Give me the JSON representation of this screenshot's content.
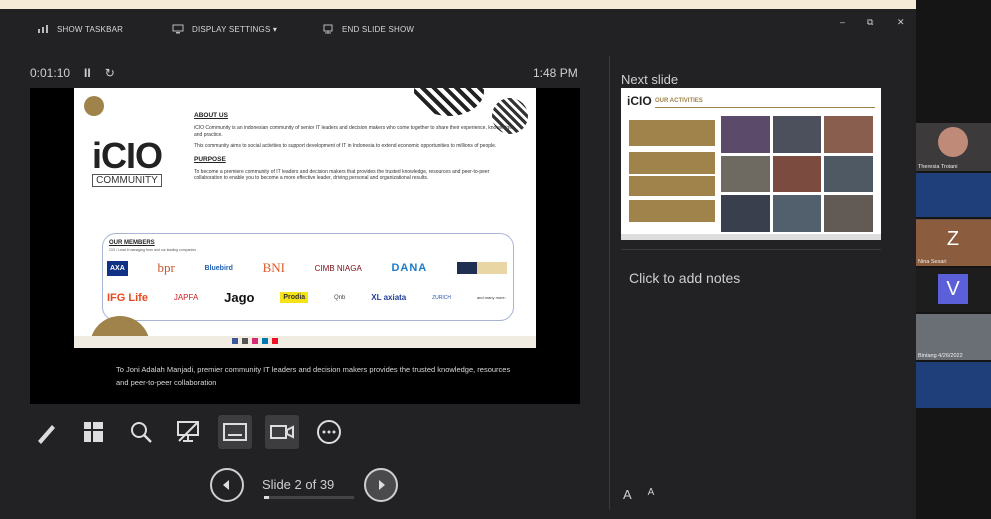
{
  "toolbar": {
    "show_taskbar": "SHOW TASKBAR",
    "display_settings": "DISPLAY SETTINGS ▾",
    "end_slide_show": "END SLIDE SHOW"
  },
  "window_controls": {
    "minimize": "–",
    "restore": "⧉",
    "close": "✕"
  },
  "presenter": {
    "timer": "0:01:10",
    "clock": "1:48 PM",
    "next_slide_label": "Next slide",
    "notes_placeholder": "Click to add notes",
    "slide_number": "Slide 2 of 39",
    "progress": 0.051,
    "caption": "To Joni Adalah Manjadi, premier community IT leaders and decision makers provides the trusted knowledge, resources and peer-to-peer collaboration",
    "font_increase": "A",
    "font_decrease": "A"
  },
  "slide": {
    "logo_main": "iCIO",
    "logo_sub": "COMMUNITY",
    "about_heading": "ABOUT US",
    "about_text_1": "iCIO Community is an indonesian community of senior IT leaders and decision makers who come together to share their experience, knowledge and practice.",
    "about_text_2": "This community aims to social activities to support development of IT in Indonesia to extend economic opportunities to millions of people.",
    "purpose_heading": "PURPOSE",
    "purpose_text": "To become a premiere community of IT leaders and decision makers that provides the trusted knowledge, resources and peer-to-peer collaboration to enable you to become a more effective leader, driving personal and organizational results.",
    "members_heading": "OUR MEMBERS",
    "members_sub": "CIO / Lead it managing from and our leading companies",
    "members_row1": [
      "AXA",
      "bpr",
      "Bluebird",
      "BNI",
      "CIMB NIAGA",
      "DANA",
      ""
    ],
    "members_row2": [
      "IFG Life",
      "JAPFA",
      "Jago",
      "Prodia",
      "Qnb",
      "XL axiata",
      "ZURICH",
      "and many more.."
    ]
  },
  "next_slide": {
    "logo": "iCIO",
    "title": "OUR ACTIVITIES"
  },
  "participants": [
    {
      "name": "Theresia Troiani",
      "avatar": ""
    },
    {
      "name": "",
      "avatar": ""
    },
    {
      "name": "",
      "avatar": ""
    },
    {
      "name": "Nina Sesari",
      "avatar": "Z"
    },
    {
      "name": "",
      "avatar": "V"
    },
    {
      "name": "Bintang 4/26/2022",
      "avatar": ""
    },
    {
      "name": "",
      "avatar": ""
    }
  ],
  "colors": {
    "accent_gold": "#a0834a",
    "background": "#222224",
    "sidebar": "#151515"
  }
}
